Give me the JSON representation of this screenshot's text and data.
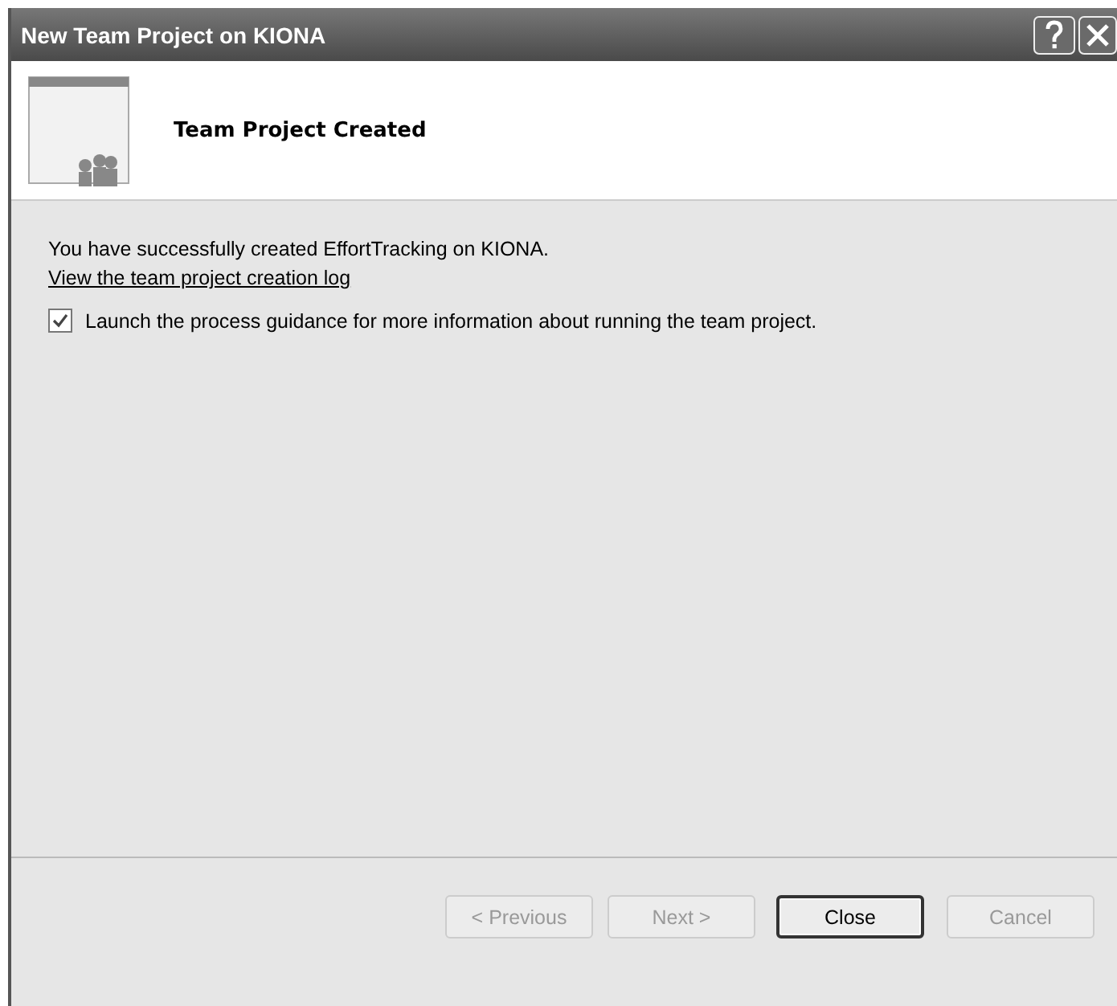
{
  "window": {
    "title": "New Team Project on KIONA"
  },
  "header": {
    "title": "Team Project Created"
  },
  "message": "You have successfully created EffortTracking on KIONA.",
  "link": "View the team project creation log",
  "checkbox": {
    "label": "Launch the process guidance for more information about running the team project.",
    "checked": true
  },
  "buttons": [
    {
      "label": "< Previous",
      "disabled": true,
      "default": false
    },
    {
      "label": "Next >",
      "disabled": true,
      "default": false
    },
    {
      "label": "Close",
      "disabled": false,
      "default": true
    },
    {
      "label": "Cancel",
      "disabled": true,
      "default": false
    }
  ]
}
